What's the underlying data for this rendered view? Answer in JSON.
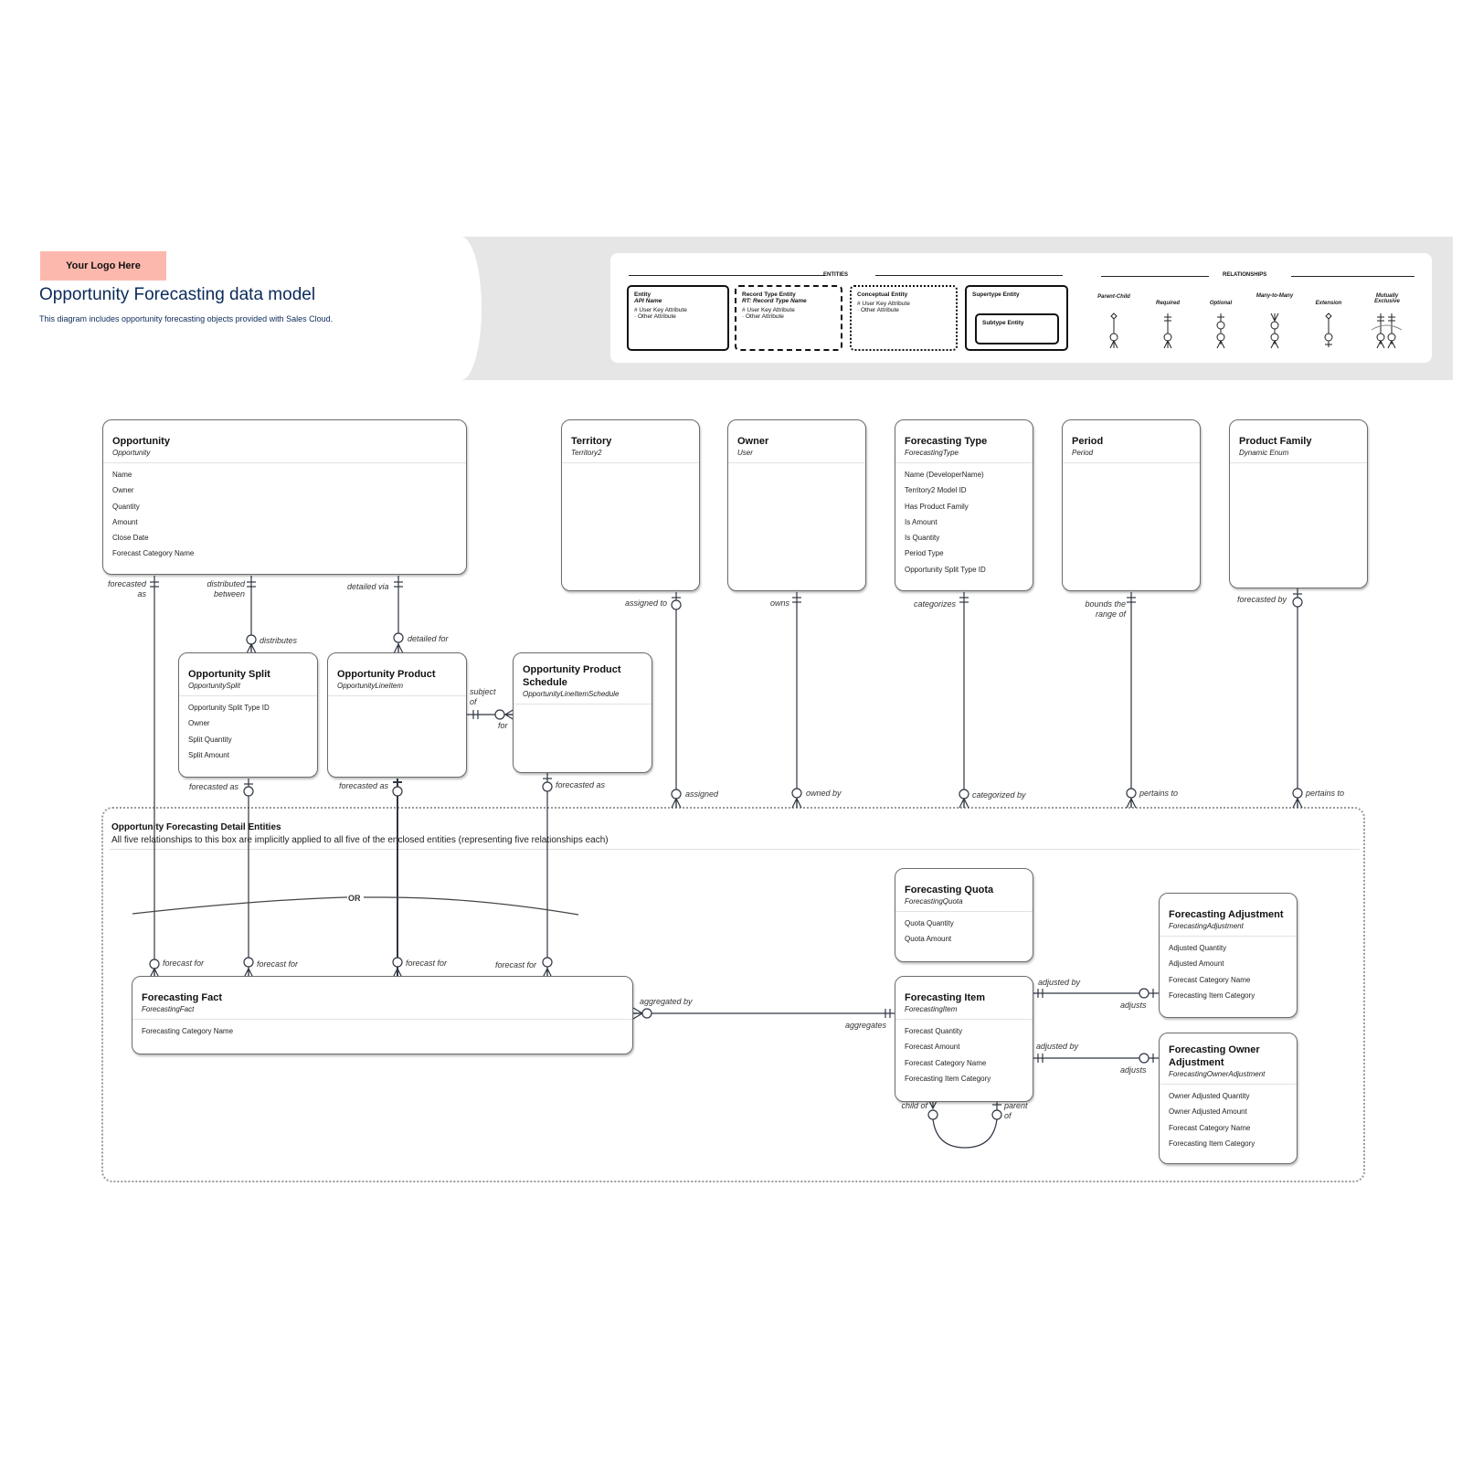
{
  "header": {
    "logo_text": "Your Logo Here",
    "title": "Opportunity Forecasting data model",
    "subtitle": "This diagram includes opportunity forecasting objects provided with Sales Cloud."
  },
  "legend": {
    "entities_heading": "ENTITIES",
    "relationships_heading": "RELATIONSHIPS",
    "entity_types": [
      {
        "name": "Entity",
        "sub": "API Name",
        "attr1": "# User Key Attribute",
        "attr2": "· Other Attribute",
        "border": "solid"
      },
      {
        "name": "Record Type Entity",
        "sub": "RT: Record Type Name",
        "attr1": "# User Key Attribute",
        "attr2": "· Other Attribute",
        "border": "dashed"
      },
      {
        "name": "Conceptual Entity",
        "sub": "",
        "attr1": "# User Key Attribute",
        "attr2": "· Other Attribute",
        "border": "dotted"
      },
      {
        "name": "Supertype Entity",
        "sub": "",
        "subtype": "Subtype Entity",
        "border": "solid"
      }
    ],
    "relationship_types": [
      "Parent-Child",
      "Required",
      "Optional",
      "Many-to-Many",
      "Extension",
      "Mutually Exclusive"
    ]
  },
  "entities": {
    "opportunity": {
      "name": "Opportunity",
      "api": "Opportunity",
      "attrs": [
        "Name",
        "Owner",
        "Quantity",
        "Amount",
        "Close Date",
        "Forecast Category Name"
      ]
    },
    "territory": {
      "name": "Territory",
      "api": "Territory2",
      "attrs": []
    },
    "owner": {
      "name": "Owner",
      "api": "User",
      "attrs": []
    },
    "forecasting_type": {
      "name": "Forecasting Type",
      "api": "ForecastingType",
      "attrs": [
        "Name (DeveloperName)",
        "Territory2 Model ID",
        "Has Product Family",
        "Is Amount",
        "Is Quantity",
        "Period Type",
        "Opportunity Split Type ID"
      ]
    },
    "period": {
      "name": "Period",
      "api": "Period",
      "attrs": []
    },
    "product_family": {
      "name": "Product Family",
      "api": "Dynamic Enum",
      "attrs": []
    },
    "opportunity_split": {
      "name": "Opportunity Split",
      "api": "OpportunitySplit",
      "attrs": [
        "Opportunity Split Type ID",
        "Owner",
        "Split Quantity",
        "Split Amount"
      ]
    },
    "opportunity_product": {
      "name": "Opportunity Product",
      "api": "OpportunityLineItem",
      "attrs": []
    },
    "opportunity_product_schedule": {
      "name": "Opportunity Product Schedule",
      "api": "OpportunityLineItemSchedule",
      "attrs": []
    },
    "forecasting_fact": {
      "name": "Forecasting Fact",
      "api": "ForecastingFact",
      "attrs": [
        "Forecasting Category Name"
      ]
    },
    "forecasting_quota": {
      "name": "Forecasting Quota",
      "api": "ForecastingQuota",
      "attrs": [
        "Quota Quantity",
        "Quota Amount"
      ]
    },
    "forecasting_item": {
      "name": "Forecasting Item",
      "api": "ForecastingItem",
      "attrs": [
        "Forecast Quantity",
        "Forecast Amount",
        "Forecast Category Name",
        "Forecasting Item Category"
      ]
    },
    "forecasting_adjustment": {
      "name": "Forecasting Adjustment",
      "api": "ForecastingAdjustment",
      "attrs": [
        "Adjusted Quantity",
        "Adjusted Amount",
        "Forecast Category Name",
        "Forecasting Item Category"
      ]
    },
    "forecasting_owner_adjustment": {
      "name": "Forecasting Owner Adjustment",
      "api": "ForecastingOwnerAdjustment",
      "attrs": [
        "Owner Adjusted Quantity",
        "Owner Adjusted Amount",
        "Forecast Category Name",
        "Forecasting Item Category"
      ]
    }
  },
  "container": {
    "title": "Opportunity Forecasting Detail Entities",
    "description": "All five relationships to this box are implicitly applied to all five of the enclosed entities (representing five relationships each)"
  },
  "or_label": "OR",
  "relationship_labels": {
    "opp_forecasted_as": "forecasted as",
    "opp_distributed_between": "distributed between",
    "opp_detailed_via": "detailed via",
    "split_distributes": "distributes",
    "product_detailed_for": "detailed for",
    "product_subject_of": "subject of",
    "schedule_for": "for",
    "split_forecasted_as": "forecasted as",
    "product_forecasted_as": "forecasted as",
    "schedule_forecasted_as": "forecasted as",
    "territory_assigned_to": "assigned to",
    "owner_owns": "owns",
    "ftype_categorizes": "categorizes",
    "period_bounds": "bounds the range of",
    "pfamily_forecasted_by": "forecasted by",
    "box_assigned": "assigned",
    "box_owned_by": "owned by",
    "box_categorized_by": "categorized by",
    "box_pertains_to_1": "pertains to",
    "box_pertains_to_2": "pertains to",
    "fact_forecast_for_1": "forecast for",
    "fact_forecast_for_2": "forecast for",
    "fact_forecast_for_3": "forecast for",
    "fact_forecast_for_4": "forecast for",
    "fact_aggregated_by": "aggregated by",
    "item_aggregates": "aggregates",
    "item_adjusted_by_1": "adjusted by",
    "adj_adjusts": "adjusts",
    "item_adjusted_by_2": "adjusted by",
    "owner_adj_adjusts": "adjusts",
    "item_child_of": "child of",
    "item_parent_of": "parent of"
  }
}
